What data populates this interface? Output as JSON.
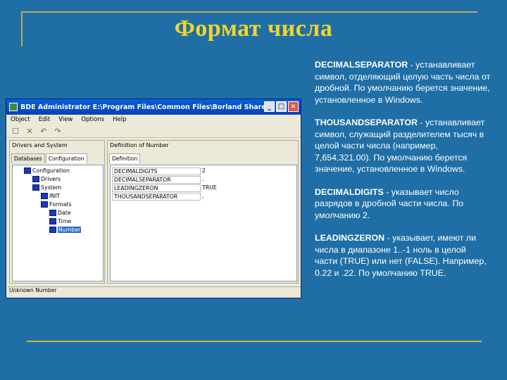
{
  "slide": {
    "title": "Формат числа"
  },
  "descriptions": [
    {
      "term": "DECIMALSEPARATOR",
      "text": " - устанавливает символ, отделяющий целую часть числа от дробной. По умолчанию берется значение, установленное в Windows."
    },
    {
      "term": "THOUSANDSEPARATOR",
      "text": " - устанавливает символ, служащий разделителем тысяч в целой части числа (например, 7,654,321.00). По умолчанию берется значение, установленное в Windows."
    },
    {
      "term": "DECIMALDIGITS",
      "text": " - указывает число разрядов в дробной части числа. По умолчанию 2."
    },
    {
      "term": "LEADINGZERON",
      "text": " - указывает, имеют ли числа в диапазоне 1..-1 ноль в целой части (TRUE) или нет (FALSE). Например, 0.22 и .22. По умолчанию TRUE."
    }
  ],
  "window": {
    "title": "BDE Administrator  E:\\Program Files\\Common Files\\Borland Shared\\BDF\\...",
    "min": "_",
    "max": "□",
    "close": "×",
    "menu": [
      "Object",
      "Edit",
      "View",
      "Options",
      "Help"
    ],
    "left_panel_title": "Drivers and System",
    "tabs": [
      "Databases",
      "Configuration"
    ],
    "tree": [
      "Configuration",
      "Drivers",
      "System",
      "INIT",
      "Formats",
      "Date",
      "Time",
      "Number"
    ],
    "right_panel_title": "Definition of Number",
    "right_tab": "Definition",
    "rows": [
      {
        "key": "DECIMALDIGITS",
        "value": "2"
      },
      {
        "key": "DECIMALSEPARATOR",
        "value": "."
      },
      {
        "key": "LEADINGZERON",
        "value": "TRUE"
      },
      {
        "key": "THOUSANDSEPARATOR",
        "value": ","
      }
    ],
    "status": "Unknown Number"
  }
}
